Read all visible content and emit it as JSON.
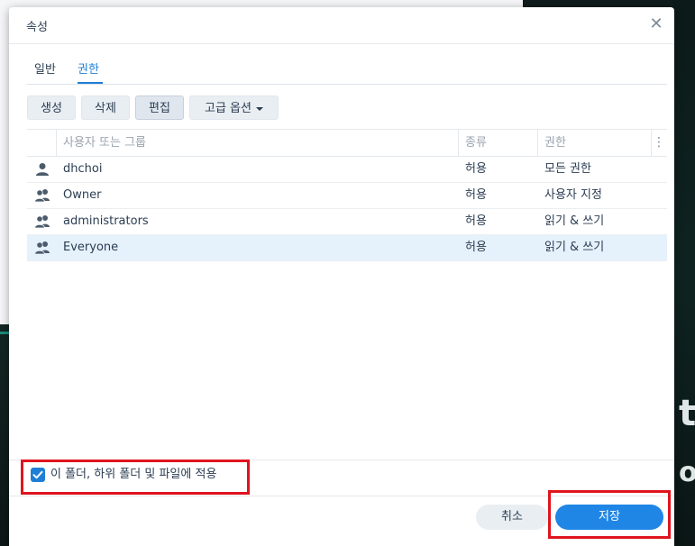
{
  "dialog": {
    "title": "속성",
    "close_glyph": "✕"
  },
  "tabs": [
    {
      "label": "일반",
      "active": false
    },
    {
      "label": "권한",
      "active": true
    }
  ],
  "toolbar": {
    "create": "생성",
    "delete": "삭제",
    "edit": "편집",
    "advanced": "고급 옵션"
  },
  "table": {
    "columns": [
      "사용자 또는 그룹",
      "종류",
      "권한"
    ],
    "menu_glyph": "⋮",
    "rows": [
      {
        "icon": "user-icon",
        "name": "dhchoi",
        "type": "허용",
        "permission": "모든 권한",
        "selected": false
      },
      {
        "icon": "group-icon",
        "name": "Owner",
        "type": "허용",
        "permission": "사용자 지정",
        "selected": false
      },
      {
        "icon": "group-icon",
        "name": "administrators",
        "type": "허용",
        "permission": "읽기 & 쓰기",
        "selected": false
      },
      {
        "icon": "group-icon",
        "name": "Everyone",
        "type": "허용",
        "permission": "읽기 & 쓰기",
        "selected": true
      }
    ]
  },
  "apply": {
    "label": "이 폴더, 하위 폴더 및 파일에 적용",
    "checked": true
  },
  "footer": {
    "cancel": "취소",
    "save": "저장"
  },
  "colors": {
    "accent": "#1f7ed6",
    "highlight": "#e0141e",
    "selected_row": "#e5f1fb"
  }
}
